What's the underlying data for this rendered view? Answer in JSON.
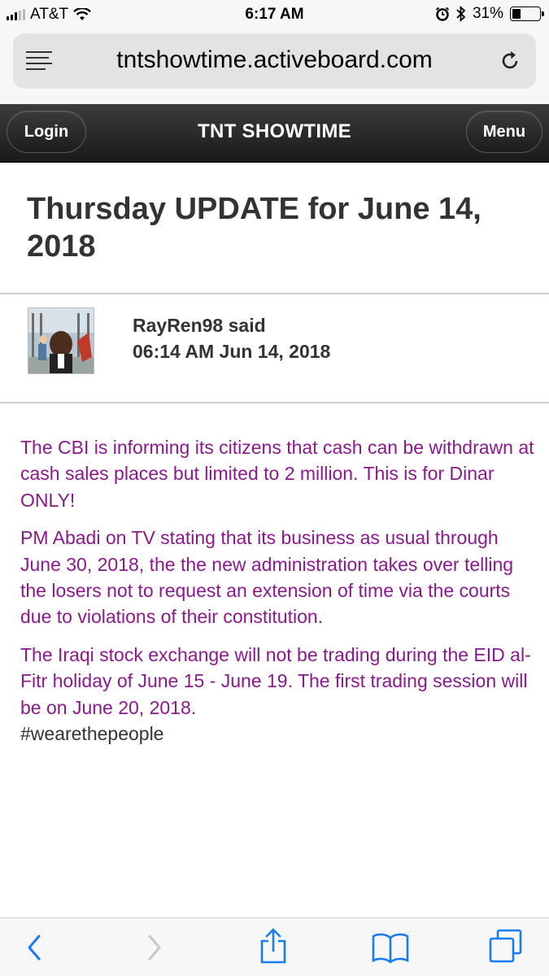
{
  "status_bar": {
    "carrier": "AT&T",
    "time": "6:17 AM",
    "battery": "31%",
    "battery_level": 0.31,
    "icons": [
      "signal-icon",
      "wifi-icon",
      "alarm-icon",
      "bluetooth-icon",
      "battery-icon"
    ]
  },
  "url_bar": {
    "url": "tntshowtime.activeboard.com",
    "icons": [
      "reader-menu-icon",
      "reload-icon"
    ]
  },
  "header": {
    "login_label": "Login",
    "title": "TNT SHOWTIME",
    "menu_label": "Menu"
  },
  "post": {
    "title": "Thursday UPDATE for June 14, 2018",
    "author_line": "RayRen98 said",
    "timestamp": "06:14 AM Jun 14, 2018",
    "paragraphs": [
      "The CBI is informing its citizens that cash can be withdrawn at cash sales places but limited to 2 million. This is for Dinar ONLY!",
      "PM Abadi on TV stating that its business as usual through June 30, 2018, the the new administration takes over telling the losers not to request an extension of time via the courts due to violations of their constitution.",
      "The Iraqi stock exchange will not be trading during the EID al-Fitr holiday of June 15 - June 19. The first trading session will be on June 20, 2018."
    ],
    "hashtag": "#wearethepeople",
    "text_color": "#8a1a8c"
  },
  "toolbar": {
    "icons": [
      "back-icon",
      "forward-icon",
      "share-icon",
      "bookmarks-icon",
      "tabs-icon"
    ],
    "accent": "#1a7cf5"
  }
}
